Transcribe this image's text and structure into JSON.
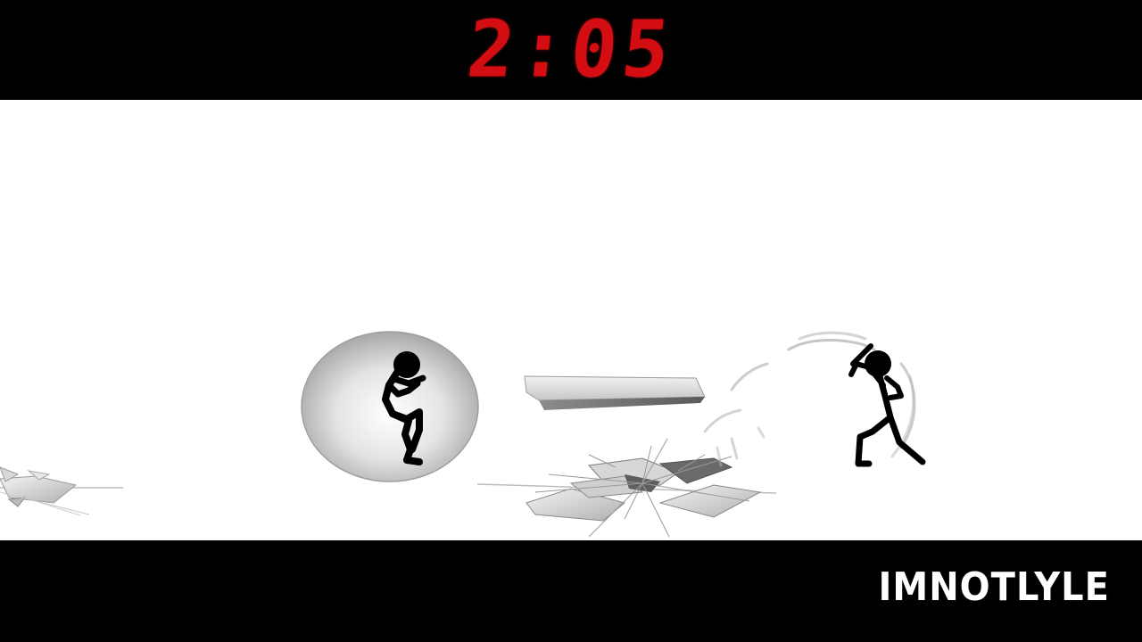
{
  "hud": {
    "timer": "2:05",
    "timer_color": "#d40d12"
  },
  "overlay": {
    "watermark": "IMNOTLYLE"
  },
  "scene": {
    "background_color": "#ffffff",
    "letterbox_color": "#000000",
    "characters": [
      {
        "name": "left-stickman",
        "state": "shielded"
      },
      {
        "name": "right-stickman",
        "state": "spinning"
      }
    ]
  }
}
